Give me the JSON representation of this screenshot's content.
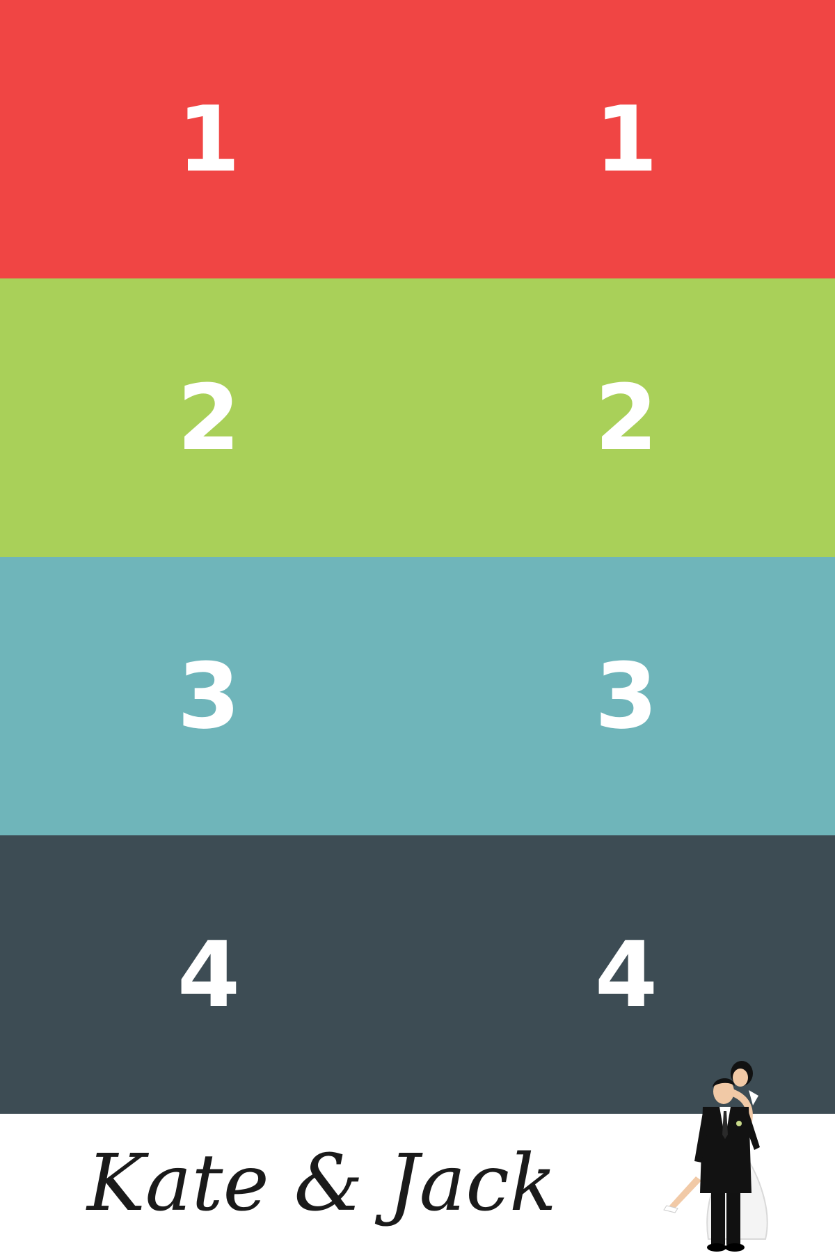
{
  "rows": [
    {
      "left": "1",
      "right": "1",
      "color": "#f04544"
    },
    {
      "left": "2",
      "right": "2",
      "color": "#a9d059"
    },
    {
      "left": "3",
      "right": "3",
      "color": "#6fb5ba"
    },
    {
      "left": "4",
      "right": "4",
      "color": "#3d4c54"
    }
  ],
  "footer": {
    "names": "Kate & Jack",
    "illustration": "bride-and-groom-icon"
  }
}
